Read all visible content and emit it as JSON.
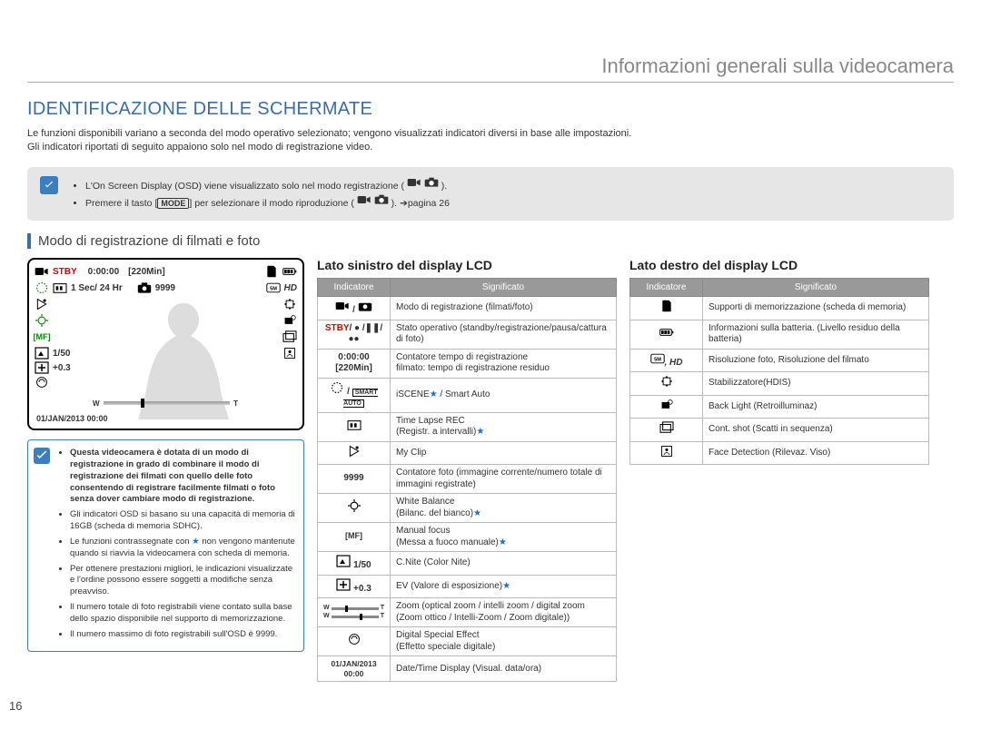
{
  "header": {
    "title": "Informazioni generali sulla videocamera"
  },
  "main_title": "IDENTIFICAZIONE DELLE SCHERMATE",
  "intro": {
    "line1": "Le funzioni disponibili variano a seconda del modo operativo selezionato; vengono visualizzati indicatori diversi in base alle impostazioni.",
    "line2": "Gli indicatori riportati di seguito appaiono solo nel modo di registrazione video."
  },
  "notebox": {
    "b1_a": "L'On Screen Display (OSD) viene visualizzato solo nel modo registrazione (",
    "b1_b": ").",
    "b2_a": "Premere il tasto [",
    "b2_mode": "MODE",
    "b2_b": "] per selezionare il modo riproduzione (",
    "b2_c": "). ",
    "b2_d": "pagina 26"
  },
  "section_title": "Modo di registrazione di filmati e foto",
  "lcd": {
    "stby": "STBY",
    "time": "0:00:00",
    "remain": "[220Min]",
    "interval": "1 Sec/ 24 Hr",
    "photos": "9999",
    "shutter": "1/50",
    "ev": "+0.3",
    "zoom_w": "W",
    "zoom_t": "T",
    "date": "01/JAN/2013 00:00",
    "hd": "HD"
  },
  "subnote": {
    "b1": "Questa videocamera è dotata di un modo di registrazione in grado di combinare il modo di registrazione dei filmati con quello delle foto consentendo di registrare facilmente filmati o foto senza dover cambiare modo di registrazione.",
    "b2": "Gli indicatori OSD si basano su una capacità di memoria di 16GB (scheda di memoria SDHC).",
    "b3a": "Le funzioni contrassegnate con ",
    "b3b": " non vengono mantenute quando si riavvia la videocamera con scheda di memoria.",
    "b4": "Per ottenere prestazioni migliori, le indicazioni visualizzate e l'ordine possono essere soggetti a modifiche senza preavviso.",
    "b5": "Il numero totale di foto registrabili viene contato sulla base dello spazio disponibile nel supporto di memorizzazione.",
    "b6": "Il numero massimo di foto registrabili sull'OSD è 9999."
  },
  "left_table": {
    "title": "Lato sinistro del display LCD",
    "h1": "Indicatore",
    "h2": "Significato",
    "rows": [
      {
        "ind": "vid/photo",
        "sig": "Modo di registrazione (filmati/foto)"
      },
      {
        "ind": "stby",
        "sig": "Stato operativo (standby/registrazione/pausa/cattura di foto)"
      },
      {
        "ind": "time",
        "sig": "Contatore tempo di registrazione\nfilmato: tempo di registrazione residuo"
      },
      {
        "ind": "iscene",
        "sig": "iSCENE★ / Smart Auto"
      },
      {
        "ind": "timelapse",
        "sig": "Time Lapse REC\n(Registr. a intervalli)★"
      },
      {
        "ind": "myclip",
        "sig": "My Clip"
      },
      {
        "ind": "9999",
        "sig": "Contatore foto (immagine corrente/numero totale di immagini registrate)"
      },
      {
        "ind": "wb",
        "sig": "White Balance\n(Bilanc. del bianco)★"
      },
      {
        "ind": "mf",
        "sig": "Manual focus\n(Messa a fuoco manuale)★"
      },
      {
        "ind": "cnite",
        "sig": "C.Nite (Color Nite)"
      },
      {
        "ind": "ev",
        "sig": "EV (Valore di esposizione)★"
      },
      {
        "ind": "zoom",
        "sig": "Zoom (optical zoom / intelli zoom / digital zoom (Zoom ottico / Intelli-Zoom / Zoom digitale))"
      },
      {
        "ind": "dse",
        "sig": "Digital Special Effect\n(Effetto speciale digitale)"
      },
      {
        "ind": "date",
        "sig": "Date/Time Display (Visual. data/ora)"
      }
    ],
    "ind_labels": {
      "stby_a": "STBY",
      "stby_b": "/ ● /",
      "stby_c": "/",
      "time": "0:00:00 [220Min]",
      "n9999": "9999",
      "cnite": "1/50",
      "ev": "+0.3",
      "date": "01/JAN/2013 00:00"
    }
  },
  "right_table": {
    "title": "Lato destro del display LCD",
    "h1": "Indicatore",
    "h2": "Significato",
    "rows": [
      {
        "ind": "storage",
        "sig": "Supporti di memorizzazione (scheda di memoria)"
      },
      {
        "ind": "battery",
        "sig": "Informazioni sulla batteria. (Livello residuo della batteria)"
      },
      {
        "ind": "res",
        "sig": "Risoluzione foto, Risoluzione del filmato"
      },
      {
        "ind": "hdis",
        "sig": "Stabilizzatore(HDIS)"
      },
      {
        "ind": "backlight",
        "sig": "Back Light (Retroilluminaz)"
      },
      {
        "ind": "cont",
        "sig": "Cont. shot (Scatti in sequenza)"
      },
      {
        "ind": "face",
        "sig": "Face Detection (Rilevaz. Viso)"
      }
    ],
    "res_label": ", HD"
  },
  "page_number": "16"
}
